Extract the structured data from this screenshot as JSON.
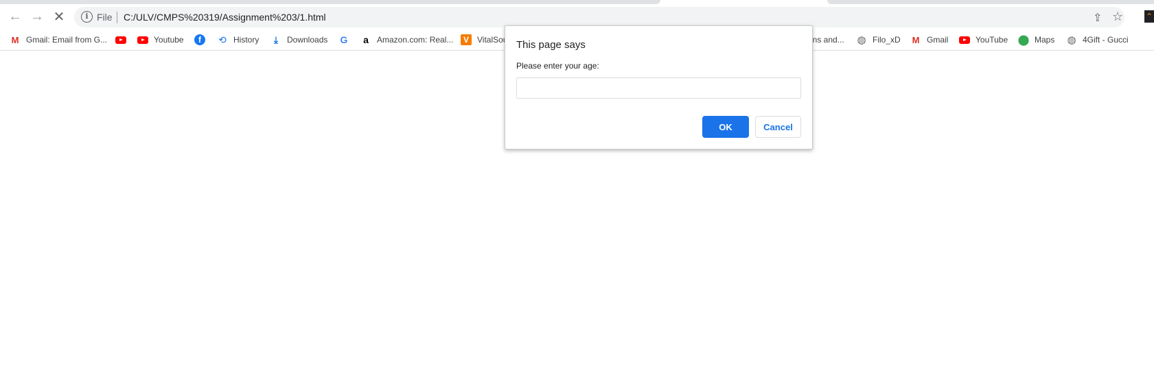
{
  "toolbar": {
    "back_icon": "←",
    "forward_icon": "→",
    "stop_icon": "✕",
    "info_icon": "i",
    "scheme_label": "File",
    "url": "C:/ULV/CMPS%20319/Assignment%203/1.html",
    "share_icon": "⇪",
    "star_icon": "☆",
    "extension_icon": "⌃"
  },
  "bookmarks": [
    {
      "label": "Gmail: Email from G...",
      "icon": "gmail-icon",
      "glyph": "M"
    },
    {
      "label": "",
      "icon": "youtube-icon",
      "glyph": ""
    },
    {
      "label": "Youtube",
      "icon": "youtube-icon",
      "glyph": ""
    },
    {
      "label": "",
      "icon": "facebook-icon",
      "glyph": "f"
    },
    {
      "label": "History",
      "icon": "history-icon",
      "glyph": "⟲"
    },
    {
      "label": "Downloads",
      "icon": "download-icon",
      "glyph": "⤓"
    },
    {
      "label": "",
      "icon": "google-icon",
      "glyph": "G"
    },
    {
      "label": "Amazon.com: Real...",
      "icon": "amazon-icon",
      "glyph": "a"
    },
    {
      "label": "VitalSou",
      "icon": "vitalsource-icon",
      "glyph": "V"
    },
    {
      "label": "ans and...",
      "icon": "",
      "glyph": ""
    },
    {
      "label": "Filo_xD",
      "icon": "globe-icon",
      "glyph": "◍"
    },
    {
      "label": "Gmail",
      "icon": "gmail-icon",
      "glyph": "M"
    },
    {
      "label": "YouTube",
      "icon": "youtube-icon",
      "glyph": ""
    },
    {
      "label": "Maps",
      "icon": "maps-icon",
      "glyph": "⬤"
    },
    {
      "label": "4Gift - Gucci",
      "icon": "globe-icon",
      "glyph": "◍"
    }
  ],
  "dialog": {
    "title": "This page says",
    "message": "Please enter your age:",
    "input_value": "",
    "ok_label": "OK",
    "cancel_label": "Cancel"
  },
  "colors": {
    "accent": "#1a73e8",
    "omnibox_bg": "#f1f3f4"
  }
}
